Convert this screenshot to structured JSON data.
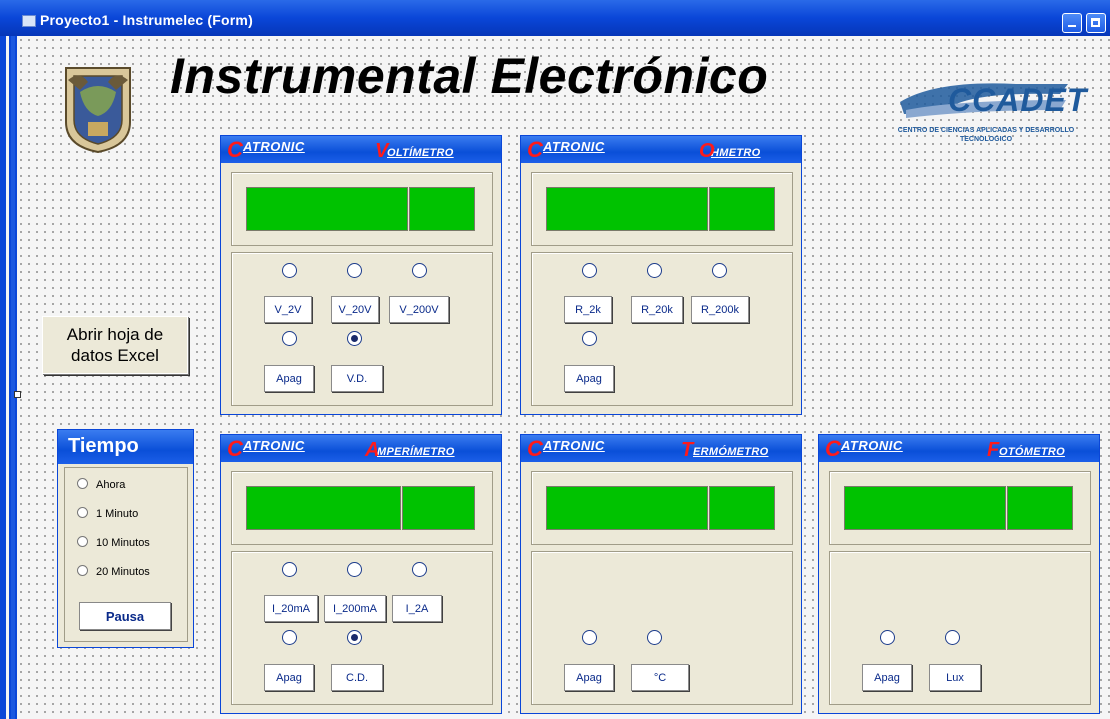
{
  "window": {
    "title": "Proyecto1 - Instrumelec (Form)"
  },
  "header": {
    "title": "Instrumental  Electrónico"
  },
  "ccadet": {
    "logo_text": "CCADET",
    "description": "CENTRO DE CIENCIAS APLICADAS Y DESARROLLO TECNOLOGICO"
  },
  "excel_button": {
    "line1": "Abrir hoja de",
    "line2": "datos Excel"
  },
  "tiempo": {
    "title": "Tiempo",
    "options": [
      "Ahora",
      "1 Minuto",
      "10 Minutos",
      "20 Minutos"
    ],
    "pausa": "Pausa"
  },
  "brand": {
    "first": "C",
    "rest": "ATRONIC"
  },
  "voltimetro": {
    "title_first": "V",
    "title_rest": "OLTÍMETRO",
    "buttons": [
      "V_2V",
      "V_20V",
      "V_200V",
      "Apag",
      "V.D."
    ],
    "selected": "V.D."
  },
  "ohmetro": {
    "title_first": "O",
    "title_rest": "HMETRO",
    "buttons": [
      "R_2k",
      "R_20k",
      "R_200k",
      "Apag"
    ]
  },
  "amperimetro": {
    "title_first": "A",
    "title_rest": "MPERÍMETRO",
    "buttons": [
      "I_20mA",
      "I_200mA",
      "I_2A",
      "Apag",
      "C.D."
    ],
    "selected": "C.D."
  },
  "termometro": {
    "title_first": "T",
    "title_rest": "ERMÓMETRO",
    "buttons": [
      "Apag",
      "°C"
    ]
  },
  "fotometro": {
    "title_first": "F",
    "title_rest": "OTÓMETRO",
    "buttons": [
      "Apag",
      "Lux"
    ]
  }
}
